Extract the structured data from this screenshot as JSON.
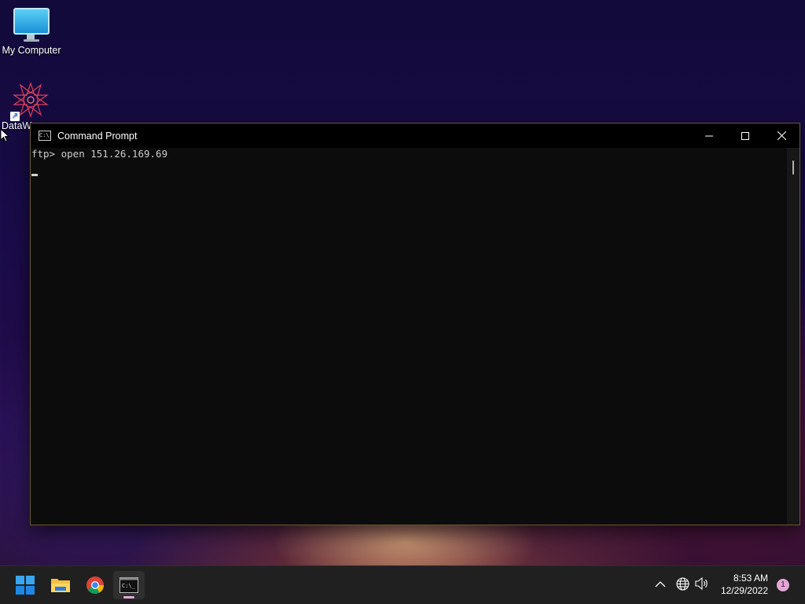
{
  "desktop": {
    "icons": [
      {
        "label": "My Computer"
      },
      {
        "label": "DataW"
      }
    ]
  },
  "cmd": {
    "title": "Command Prompt",
    "lines": [
      "ftp> open 151.26.169.69"
    ]
  },
  "taskbar": {
    "apps": [
      "start",
      "file-explorer",
      "chrome",
      "command-prompt"
    ],
    "active_app": "command-prompt",
    "time": "8:53 AM",
    "date": "12/29/2022",
    "notification_count": "1"
  },
  "colors": {
    "taskbar_bg": "#202020",
    "terminal_bg": "#0c0c0c",
    "terminal_text": "#cccccc",
    "accent": "#e4a6d7"
  }
}
